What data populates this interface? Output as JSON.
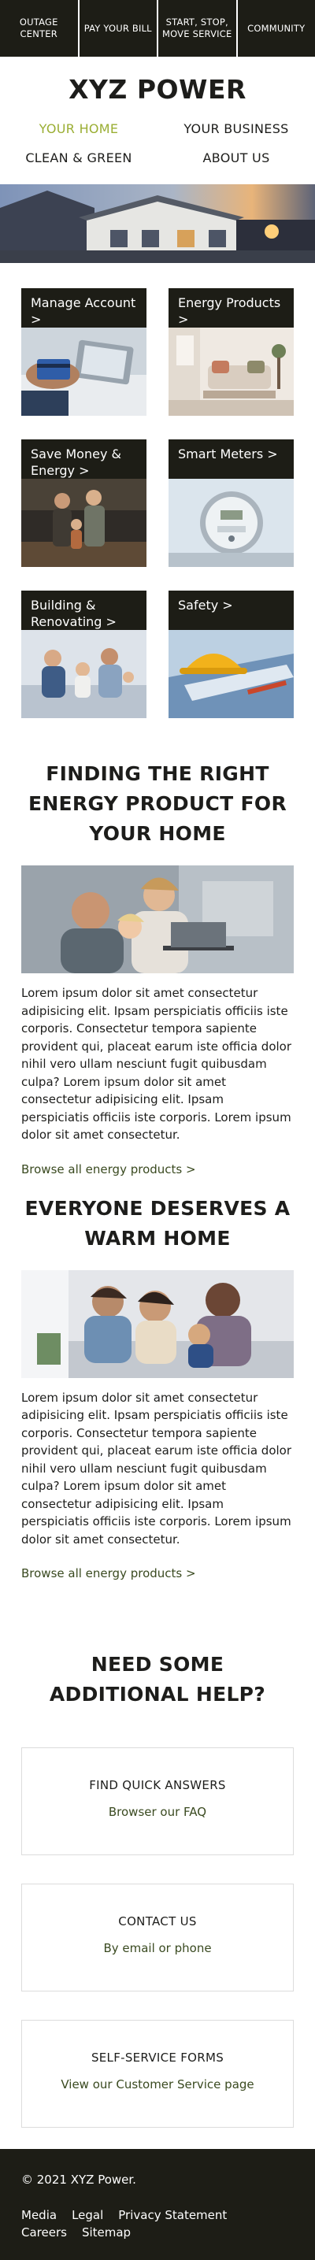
{
  "topnav": [
    {
      "label": "OUTAGE CENTER"
    },
    {
      "label": "PAY YOUR BILL"
    },
    {
      "label": "START, STOP, MOVE SERVICE"
    },
    {
      "label": "COMMUNITY"
    }
  ],
  "brand": "XYZ POWER",
  "mainnav": [
    {
      "label": "YOUR HOME",
      "active": true
    },
    {
      "label": "YOUR BUSINESS"
    },
    {
      "label": "CLEAN & GREEN"
    },
    {
      "label": "ABOUT US"
    }
  ],
  "tiles": [
    {
      "label": "Manage Account >",
      "icon": "hands-with-card-and-phone-photo"
    },
    {
      "label": "Energy Products >",
      "icon": "living-room-photo"
    },
    {
      "label": "Save Money & Energy >",
      "icon": "family-walking-photo"
    },
    {
      "label": "Smart Meters >",
      "icon": "electric-meter-photo"
    },
    {
      "label": "Building & Renovating >",
      "icon": "family-on-sofa-photo"
    },
    {
      "label": "Safety >",
      "icon": "hard-hat-and-blueprints-photo"
    }
  ],
  "articles": [
    {
      "title": "FINDING THE RIGHT ENERGY PRODUCT FOR YOUR HOME",
      "body": "Lorem ipsum dolor sit amet consectetur adipisicing elit. Ipsam perspiciatis officiis iste corporis. Consectetur tempora sapiente provident qui, placeat earum iste officia dolor nihil vero ullam nesciunt fugit quibusdam culpa? Lorem ipsum dolor sit amet consectetur adipisicing elit. Ipsam perspiciatis officiis iste corporis. Lorem ipsum dolor sit amet consectetur.",
      "link": "Browse all energy products >"
    },
    {
      "title": "EVERYONE DESERVES A WARM HOME",
      "body": "Lorem ipsum dolor sit amet consectetur adipisicing elit. Ipsam perspiciatis officiis iste corporis. Consectetur tempora sapiente provident qui, placeat earum iste officia dolor nihil vero ullam nesciunt fugit quibusdam culpa? Lorem ipsum dolor sit amet consectetur adipisicing elit. Ipsam perspiciatis officiis iste corporis. Lorem ipsum dolor sit amet consectetur.",
      "link": "Browse all energy products >"
    }
  ],
  "help": {
    "title": "NEED SOME ADDITIONAL HELP?",
    "cards": [
      {
        "title": "FIND QUICK ANSWERS",
        "link": "Browser our FAQ"
      },
      {
        "title": "CONTACT US",
        "link": "By email or phone"
      },
      {
        "title": "SELF-SERVICE FORMS",
        "link": "View our Customer Service page"
      }
    ]
  },
  "footer": {
    "copyright": "© 2021 XYZ Power.",
    "links": [
      "Media",
      "Legal",
      "Privacy Statement",
      "Careers",
      "Sitemap"
    ]
  },
  "colors": {
    "dark": "#1d1d16",
    "accent": "#9aae33",
    "link": "#3a4a20"
  }
}
